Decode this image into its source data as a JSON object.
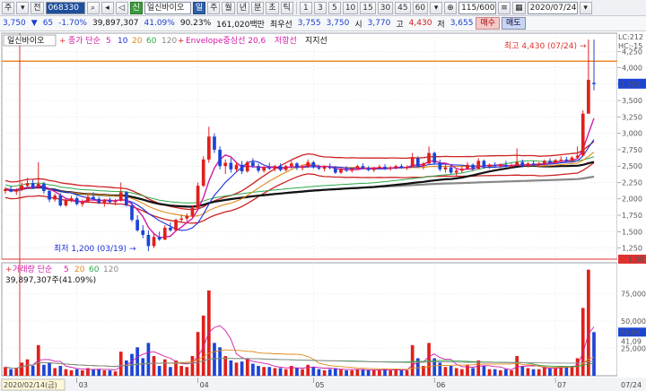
{
  "toolbar": {
    "type_label": "주",
    "mode_label": "전",
    "code": "068330",
    "badge": "신",
    "name": "일신바이오",
    "period_buttons": [
      "일",
      "주",
      "월",
      "년",
      "분",
      "초",
      "틱"
    ],
    "active_period": "일",
    "interval_buttons": [
      "1",
      "3",
      "5",
      "10",
      "15",
      "30",
      "45",
      "60"
    ],
    "count": "115/600",
    "date": "2020/07/24"
  },
  "quote": {
    "price": "3,750",
    "change": "65",
    "change_pct": "-1.70%",
    "volume": "39,897,307",
    "vol_pct": "41.09%",
    "ratio": "90.23%",
    "amount": "161,020백만",
    "best_bid_label": "최우선",
    "best_ask": "3,755",
    "best_bid": "3,750",
    "open_label": "시",
    "open": "3,770",
    "high_label": "고",
    "high": "4,430",
    "low_label": "저",
    "low": "3,655",
    "buy_label": "매수",
    "sell_label": "매도"
  },
  "legend": {
    "name": "일신바이오",
    "ma_label": "종가 단순",
    "ma_periods": [
      "5",
      "10",
      "20",
      "60",
      "120"
    ],
    "envelope": "Envelope중심선 20,6",
    "resistance": "저항선",
    "support": "지지선",
    "volume_label": "거래량 단순",
    "volume_periods": [
      "5",
      "20",
      "60",
      "120"
    ],
    "volume_value": "39,897,307주(41.09%)"
  },
  "annotations": {
    "high": "최고 4,430 (07/24)",
    "low": "최저 1,200 (03/19)"
  },
  "right_axis": {
    "tag_top": "LC:212",
    "tag_top2": "HC:-15",
    "ticks": [
      "4,250",
      "4,000",
      "3,750",
      "3,500",
      "3,250",
      "3,000",
      "2,750",
      "2,500",
      "2,250",
      "2,000",
      "1,750",
      "1,500",
      "1,250"
    ],
    "current": "3,750",
    "low_tag": "1,08",
    "vol_ticks": [
      "75,000",
      "50,000",
      "25,000"
    ],
    "vol_current": "39,89",
    "vol_pct": "41,09"
  },
  "dates": {
    "start": "2020/02/14(금)",
    "months": [
      "03",
      "04",
      "05",
      "06",
      "07"
    ],
    "end": "07/24"
  },
  "colors": {
    "up": "#e0201b",
    "down": "#1c44d6",
    "ma5": "#d11aa7",
    "ma10": "#1c2fd6",
    "ma20": "#e08a1a",
    "ma60": "#2ea84a",
    "ma120": "#888888",
    "envelope": "#cc2222"
  },
  "chart_data": {
    "type": "candlestick",
    "price_range": [
      1080,
      4500
    ],
    "volume_range": [
      0,
      100000
    ],
    "candles": [
      {
        "o": 2120,
        "h": 2180,
        "l": 2080,
        "c": 2150,
        "v": 8000
      },
      {
        "o": 2150,
        "h": 2200,
        "l": 2100,
        "c": 2110,
        "v": 6000
      },
      {
        "o": 2110,
        "h": 2160,
        "l": 2060,
        "c": 2140,
        "v": 7000
      },
      {
        "o": 2140,
        "h": 2250,
        "l": 2120,
        "c": 2200,
        "v": 12000
      },
      {
        "o": 2200,
        "h": 2320,
        "l": 2180,
        "c": 2240,
        "v": 15000
      },
      {
        "o": 2240,
        "h": 2290,
        "l": 2150,
        "c": 2170,
        "v": 9000
      },
      {
        "o": 2170,
        "h": 2560,
        "l": 2150,
        "c": 2230,
        "v": 28000
      },
      {
        "o": 2230,
        "h": 2260,
        "l": 2080,
        "c": 2120,
        "v": 10000
      },
      {
        "o": 2120,
        "h": 2140,
        "l": 1950,
        "c": 1990,
        "v": 12000
      },
      {
        "o": 1990,
        "h": 2080,
        "l": 1960,
        "c": 2050,
        "v": 7000
      },
      {
        "o": 2050,
        "h": 2090,
        "l": 1880,
        "c": 1900,
        "v": 9000
      },
      {
        "o": 1900,
        "h": 2000,
        "l": 1880,
        "c": 1980,
        "v": 6000
      },
      {
        "o": 1980,
        "h": 2050,
        "l": 1950,
        "c": 2010,
        "v": 5000
      },
      {
        "o": 2010,
        "h": 2040,
        "l": 1900,
        "c": 1920,
        "v": 6000
      },
      {
        "o": 1920,
        "h": 1990,
        "l": 1880,
        "c": 1960,
        "v": 5000
      },
      {
        "o": 1960,
        "h": 2060,
        "l": 1940,
        "c": 2030,
        "v": 7000
      },
      {
        "o": 2030,
        "h": 2100,
        "l": 1980,
        "c": 2000,
        "v": 6000
      },
      {
        "o": 2000,
        "h": 2030,
        "l": 1920,
        "c": 1940,
        "v": 6000
      },
      {
        "o": 1940,
        "h": 2000,
        "l": 1880,
        "c": 1980,
        "v": 5000
      },
      {
        "o": 1980,
        "h": 2020,
        "l": 1930,
        "c": 1950,
        "v": 5000
      },
      {
        "o": 1950,
        "h": 2000,
        "l": 1900,
        "c": 1970,
        "v": 4000
      },
      {
        "o": 1970,
        "h": 2250,
        "l": 1960,
        "c": 2100,
        "v": 22000
      },
      {
        "o": 2100,
        "h": 2120,
        "l": 1880,
        "c": 1900,
        "v": 14000
      },
      {
        "o": 1900,
        "h": 1950,
        "l": 1650,
        "c": 1680,
        "v": 20000
      },
      {
        "o": 1680,
        "h": 1750,
        "l": 1500,
        "c": 1520,
        "v": 26000
      },
      {
        "o": 1520,
        "h": 1600,
        "l": 1400,
        "c": 1450,
        "v": 16000
      },
      {
        "o": 1450,
        "h": 1520,
        "l": 1200,
        "c": 1280,
        "v": 30000
      },
      {
        "o": 1280,
        "h": 1480,
        "l": 1250,
        "c": 1420,
        "v": 18000
      },
      {
        "o": 1420,
        "h": 1500,
        "l": 1360,
        "c": 1380,
        "v": 9000
      },
      {
        "o": 1380,
        "h": 1600,
        "l": 1370,
        "c": 1560,
        "v": 15000
      },
      {
        "o": 1560,
        "h": 1640,
        "l": 1500,
        "c": 1520,
        "v": 8000
      },
      {
        "o": 1520,
        "h": 1700,
        "l": 1510,
        "c": 1680,
        "v": 14000
      },
      {
        "o": 1680,
        "h": 1760,
        "l": 1640,
        "c": 1700,
        "v": 9000
      },
      {
        "o": 1700,
        "h": 1780,
        "l": 1660,
        "c": 1740,
        "v": 8000
      },
      {
        "o": 1740,
        "h": 1900,
        "l": 1720,
        "c": 1860,
        "v": 18000
      },
      {
        "o": 1860,
        "h": 2250,
        "l": 1840,
        "c": 2200,
        "v": 40000
      },
      {
        "o": 2200,
        "h": 2650,
        "l": 2180,
        "c": 2600,
        "v": 55000
      },
      {
        "o": 2600,
        "h": 3100,
        "l": 2550,
        "c": 2950,
        "v": 78000
      },
      {
        "o": 2950,
        "h": 3000,
        "l": 2700,
        "c": 2750,
        "v": 30000
      },
      {
        "o": 2750,
        "h": 2800,
        "l": 2450,
        "c": 2500,
        "v": 26000
      },
      {
        "o": 2500,
        "h": 2600,
        "l": 2380,
        "c": 2550,
        "v": 18000
      },
      {
        "o": 2550,
        "h": 2620,
        "l": 2400,
        "c": 2450,
        "v": 14000
      },
      {
        "o": 2450,
        "h": 2560,
        "l": 2420,
        "c": 2520,
        "v": 12000
      },
      {
        "o": 2520,
        "h": 2580,
        "l": 2380,
        "c": 2420,
        "v": 13000
      },
      {
        "o": 2420,
        "h": 2580,
        "l": 2400,
        "c": 2560,
        "v": 16000
      },
      {
        "o": 2560,
        "h": 2620,
        "l": 2470,
        "c": 2500,
        "v": 11000
      },
      {
        "o": 2500,
        "h": 2540,
        "l": 2400,
        "c": 2430,
        "v": 9000
      },
      {
        "o": 2430,
        "h": 2500,
        "l": 2400,
        "c": 2480,
        "v": 8000
      },
      {
        "o": 2480,
        "h": 2550,
        "l": 2440,
        "c": 2460,
        "v": 8000
      },
      {
        "o": 2460,
        "h": 2520,
        "l": 2420,
        "c": 2500,
        "v": 7000
      },
      {
        "o": 2500,
        "h": 2540,
        "l": 2420,
        "c": 2440,
        "v": 7000
      },
      {
        "o": 2440,
        "h": 2520,
        "l": 2420,
        "c": 2500,
        "v": 6000
      },
      {
        "o": 2500,
        "h": 2580,
        "l": 2460,
        "c": 2540,
        "v": 9000
      },
      {
        "o": 2540,
        "h": 2560,
        "l": 2440,
        "c": 2470,
        "v": 7000
      },
      {
        "o": 2470,
        "h": 2520,
        "l": 2430,
        "c": 2490,
        "v": 6000
      },
      {
        "o": 2490,
        "h": 2600,
        "l": 2470,
        "c": 2560,
        "v": 10000
      },
      {
        "o": 2560,
        "h": 2580,
        "l": 2460,
        "c": 2480,
        "v": 8000
      },
      {
        "o": 2480,
        "h": 2520,
        "l": 2440,
        "c": 2460,
        "v": 6000
      },
      {
        "o": 2460,
        "h": 2510,
        "l": 2420,
        "c": 2490,
        "v": 5000
      },
      {
        "o": 2490,
        "h": 2540,
        "l": 2450,
        "c": 2470,
        "v": 6000
      },
      {
        "o": 2470,
        "h": 2500,
        "l": 2380,
        "c": 2400,
        "v": 7000
      },
      {
        "o": 2400,
        "h": 2480,
        "l": 2380,
        "c": 2450,
        "v": 6000
      },
      {
        "o": 2450,
        "h": 2500,
        "l": 2410,
        "c": 2430,
        "v": 5000
      },
      {
        "o": 2430,
        "h": 2480,
        "l": 2400,
        "c": 2460,
        "v": 5000
      },
      {
        "o": 2460,
        "h": 2520,
        "l": 2440,
        "c": 2500,
        "v": 6000
      },
      {
        "o": 2500,
        "h": 2540,
        "l": 2450,
        "c": 2470,
        "v": 6000
      },
      {
        "o": 2470,
        "h": 2500,
        "l": 2420,
        "c": 2440,
        "v": 5000
      },
      {
        "o": 2440,
        "h": 2490,
        "l": 2410,
        "c": 2470,
        "v": 5000
      },
      {
        "o": 2470,
        "h": 2520,
        "l": 2450,
        "c": 2490,
        "v": 5000
      },
      {
        "o": 2490,
        "h": 2530,
        "l": 2440,
        "c": 2460,
        "v": 6000
      },
      {
        "o": 2460,
        "h": 2500,
        "l": 2430,
        "c": 2480,
        "v": 5000
      },
      {
        "o": 2480,
        "h": 2520,
        "l": 2450,
        "c": 2500,
        "v": 6000
      },
      {
        "o": 2500,
        "h": 2530,
        "l": 2460,
        "c": 2470,
        "v": 5000
      },
      {
        "o": 2470,
        "h": 2510,
        "l": 2440,
        "c": 2490,
        "v": 5000
      },
      {
        "o": 2490,
        "h": 2700,
        "l": 2480,
        "c": 2620,
        "v": 28000
      },
      {
        "o": 2620,
        "h": 2650,
        "l": 2480,
        "c": 2500,
        "v": 16000
      },
      {
        "o": 2500,
        "h": 2560,
        "l": 2450,
        "c": 2540,
        "v": 9000
      },
      {
        "o": 2540,
        "h": 2800,
        "l": 2520,
        "c": 2700,
        "v": 30000
      },
      {
        "o": 2700,
        "h": 2720,
        "l": 2520,
        "c": 2550,
        "v": 16000
      },
      {
        "o": 2550,
        "h": 2600,
        "l": 2420,
        "c": 2450,
        "v": 12000
      },
      {
        "o": 2450,
        "h": 2520,
        "l": 2400,
        "c": 2480,
        "v": 8000
      },
      {
        "o": 2480,
        "h": 2520,
        "l": 2380,
        "c": 2400,
        "v": 9000
      },
      {
        "o": 2400,
        "h": 2460,
        "l": 2350,
        "c": 2430,
        "v": 7000
      },
      {
        "o": 2430,
        "h": 2500,
        "l": 2400,
        "c": 2460,
        "v": 6000
      },
      {
        "o": 2460,
        "h": 2560,
        "l": 2440,
        "c": 2520,
        "v": 10000
      },
      {
        "o": 2520,
        "h": 2540,
        "l": 2430,
        "c": 2460,
        "v": 7000
      },
      {
        "o": 2460,
        "h": 2620,
        "l": 2450,
        "c": 2580,
        "v": 14000
      },
      {
        "o": 2580,
        "h": 2600,
        "l": 2460,
        "c": 2490,
        "v": 9000
      },
      {
        "o": 2490,
        "h": 2540,
        "l": 2460,
        "c": 2520,
        "v": 6000
      },
      {
        "o": 2520,
        "h": 2560,
        "l": 2470,
        "c": 2500,
        "v": 6000
      },
      {
        "o": 2500,
        "h": 2540,
        "l": 2470,
        "c": 2520,
        "v": 5000
      },
      {
        "o": 2520,
        "h": 2580,
        "l": 2480,
        "c": 2490,
        "v": 6000
      },
      {
        "o": 2490,
        "h": 2540,
        "l": 2460,
        "c": 2510,
        "v": 5000
      },
      {
        "o": 2510,
        "h": 2770,
        "l": 2500,
        "c": 2560,
        "v": 18000
      },
      {
        "o": 2560,
        "h": 2600,
        "l": 2480,
        "c": 2500,
        "v": 9000
      },
      {
        "o": 2500,
        "h": 2560,
        "l": 2480,
        "c": 2540,
        "v": 7000
      },
      {
        "o": 2540,
        "h": 2580,
        "l": 2500,
        "c": 2520,
        "v": 6000
      },
      {
        "o": 2520,
        "h": 2560,
        "l": 2490,
        "c": 2540,
        "v": 6000
      },
      {
        "o": 2540,
        "h": 2600,
        "l": 2510,
        "c": 2580,
        "v": 8000
      },
      {
        "o": 2580,
        "h": 2620,
        "l": 2530,
        "c": 2550,
        "v": 7000
      },
      {
        "o": 2550,
        "h": 2610,
        "l": 2530,
        "c": 2590,
        "v": 7000
      },
      {
        "o": 2590,
        "h": 2650,
        "l": 2560,
        "c": 2600,
        "v": 9000
      },
      {
        "o": 2600,
        "h": 2640,
        "l": 2560,
        "c": 2580,
        "v": 8000
      },
      {
        "o": 2580,
        "h": 2650,
        "l": 2570,
        "c": 2630,
        "v": 9000
      },
      {
        "o": 2630,
        "h": 2800,
        "l": 2610,
        "c": 2660,
        "v": 16000
      },
      {
        "o": 2660,
        "h": 3350,
        "l": 2650,
        "c": 3300,
        "v": 62000
      },
      {
        "o": 3300,
        "h": 4430,
        "l": 3300,
        "c": 3815,
        "v": 97000
      },
      {
        "o": 3770,
        "h": 4430,
        "l": 3655,
        "c": 3750,
        "v": 39897
      }
    ]
  }
}
